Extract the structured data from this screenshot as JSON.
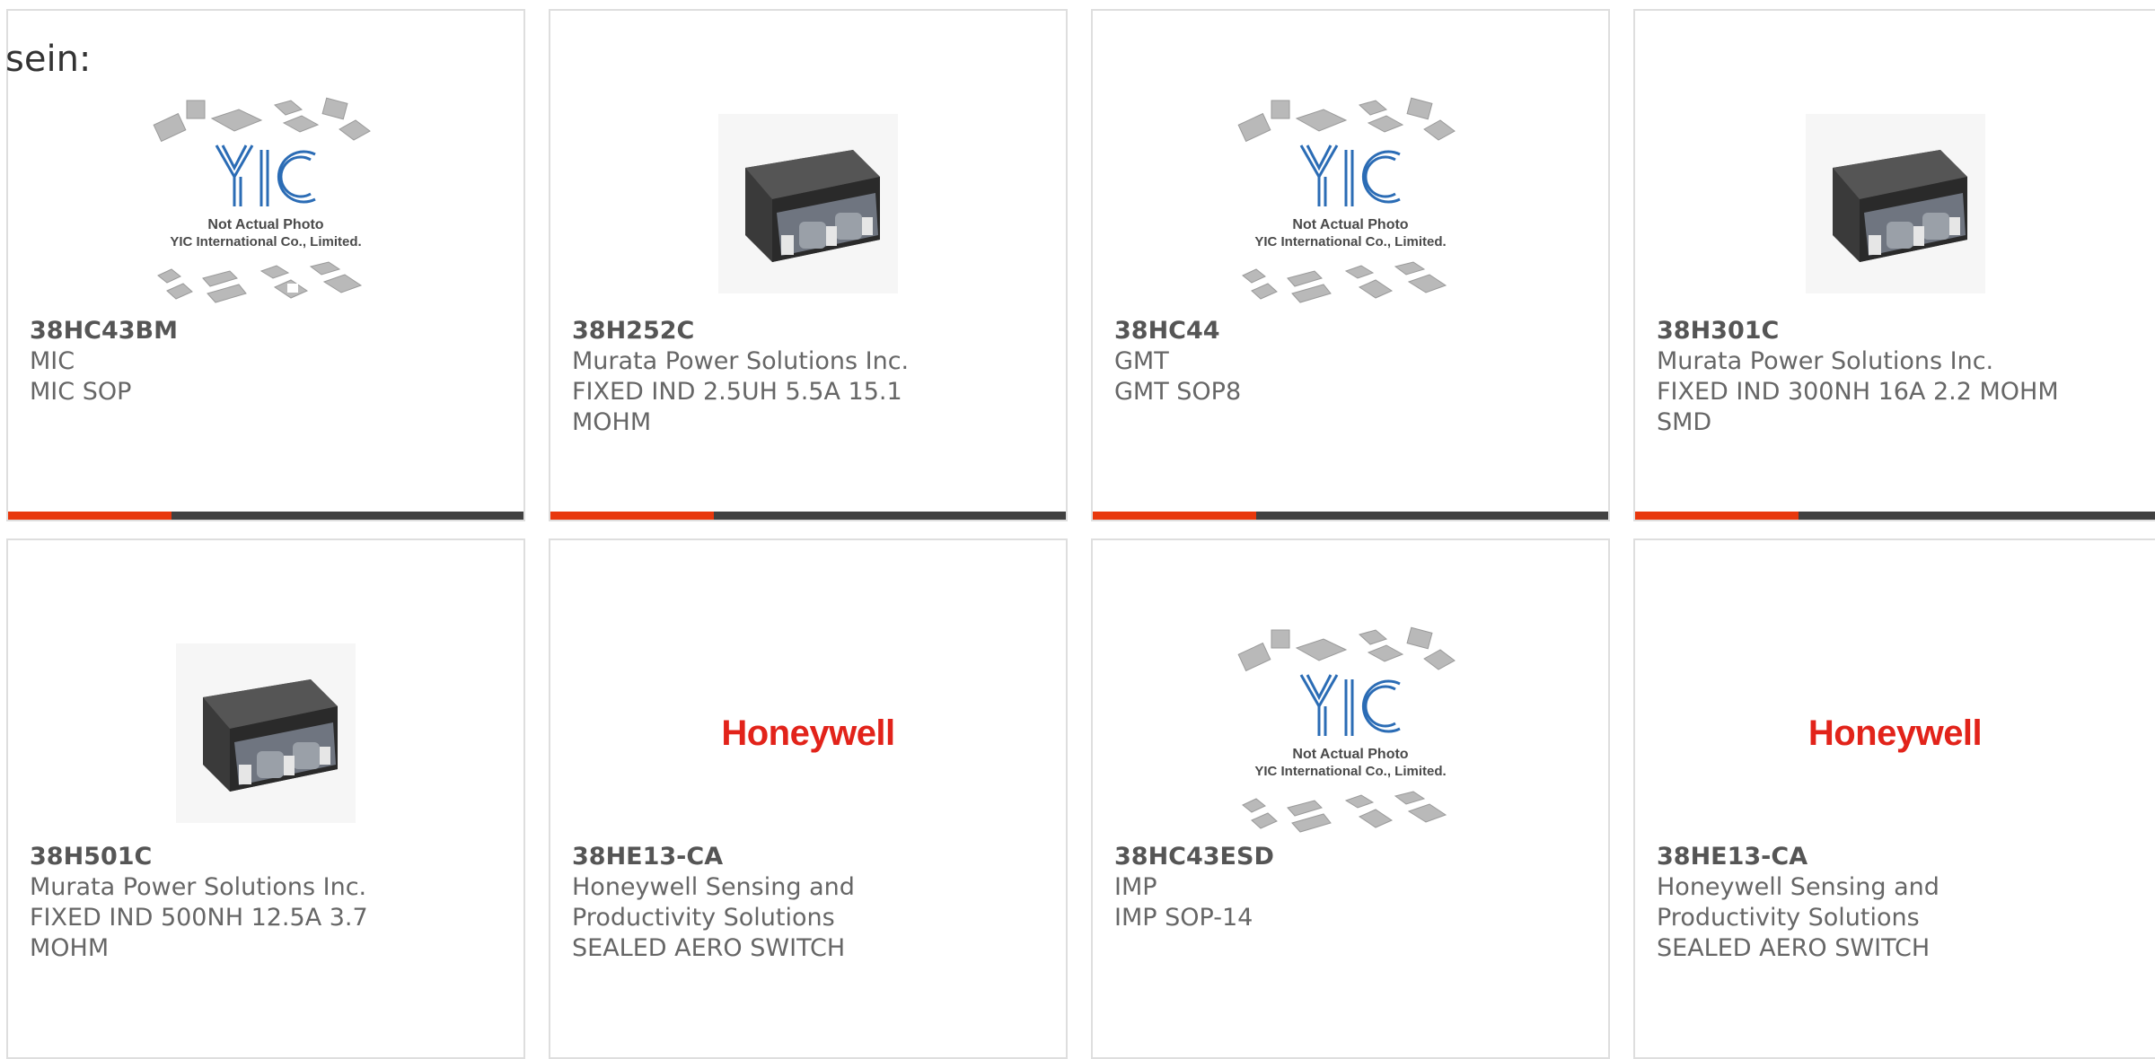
{
  "intro_text": "sein:",
  "colors": {
    "accent": "#e8380d",
    "bar": "#414141",
    "honeywell_red": "#e2231a",
    "yic_blue": "#2b6cb5"
  },
  "placeholder": {
    "line1": "Not Actual Photo",
    "line2": "YIC International Co., Limited.",
    "logo_text": "YIC"
  },
  "brand": {
    "honeywell": "Honeywell"
  },
  "products": [
    {
      "part": "38HC43BM",
      "lines": [
        "MIC",
        "MIC SOP"
      ],
      "image": "yic-placeholder-icon"
    },
    {
      "part": "38H252C",
      "lines": [
        "Murata Power Solutions Inc.",
        "FIXED IND 2.5UH 5.5A 15.1",
        "MOHM"
      ],
      "image": "inductor-icon"
    },
    {
      "part": "38HC44",
      "lines": [
        "GMT",
        "GMT SOP8"
      ],
      "image": "yic-placeholder-icon"
    },
    {
      "part": "38H301C",
      "lines": [
        "Murata Power Solutions Inc.",
        "FIXED IND 300NH 16A 2.2 MOHM",
        "SMD"
      ],
      "image": "inductor-icon"
    },
    {
      "part": "38H501C",
      "lines": [
        "Murata Power Solutions Inc.",
        "FIXED IND 500NH 12.5A 3.7",
        "MOHM"
      ],
      "image": "inductor-icon"
    },
    {
      "part": "38HE13-CA",
      "lines": [
        "Honeywell Sensing and",
        "Productivity Solutions",
        "SEALED AERO SWITCH"
      ],
      "image": "honeywell-logo"
    },
    {
      "part": "38HC43ESD",
      "lines": [
        "IMP",
        "IMP SOP-14"
      ],
      "image": "yic-placeholder-icon"
    },
    {
      "part": "38HE13-CA",
      "lines": [
        "Honeywell Sensing and",
        "Productivity Solutions",
        "SEALED AERO SWITCH"
      ],
      "image": "honeywell-logo"
    }
  ]
}
